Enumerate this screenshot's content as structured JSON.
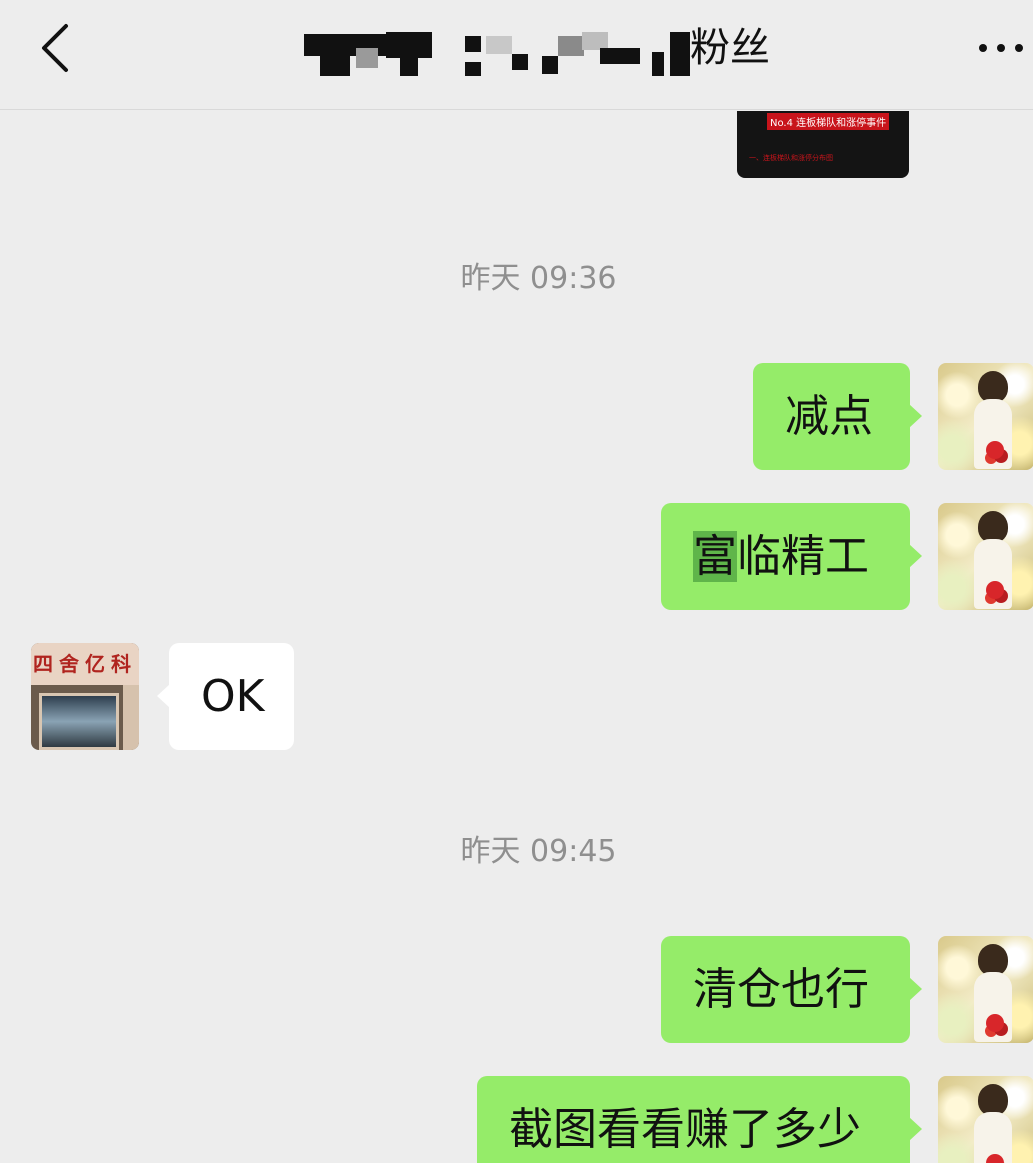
{
  "header": {
    "title_visible": "粉丝",
    "back_icon": "chevron-left-icon",
    "more_icon": "more-dots-icon"
  },
  "chat": {
    "image_message": {
      "caption": "No.4 连板梯队和涨停事件",
      "subcaption": "一、连板梯队和涨停分布图"
    },
    "timestamps": [
      "昨天 09:36",
      "昨天 09:45"
    ],
    "messages": [
      {
        "from": "me",
        "text": "减点"
      },
      {
        "from": "me",
        "highlight": "富",
        "text_rest": "临精工"
      },
      {
        "from": "them",
        "text": "OK"
      },
      {
        "from": "me",
        "text": "清仓也行"
      },
      {
        "from": "me",
        "text": "截图看看赚了多少"
      }
    ],
    "them_avatar_sign": "四舍亿科"
  },
  "colors": {
    "background": "#ededed",
    "my_bubble": "#95ec69",
    "their_bubble": "#ffffff",
    "timestamp": "#8f8f8f",
    "highlight": "#5fb54a"
  }
}
